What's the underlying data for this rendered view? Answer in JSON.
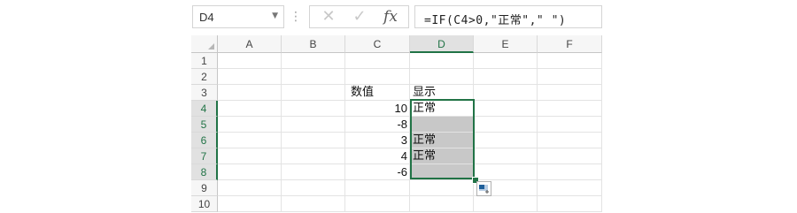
{
  "formula_bar": {
    "name_box": "D4",
    "dots": "⋮",
    "cancel_glyph": "✕",
    "enter_glyph": "✓",
    "fx_glyph": "fx",
    "formula": "=IF(C4>0,\"正常\",\" \")"
  },
  "grid": {
    "columns": [
      "A",
      "B",
      "C",
      "D",
      "E",
      "F"
    ],
    "selected_column": "D",
    "rows": [
      "1",
      "2",
      "3",
      "4",
      "5",
      "6",
      "7",
      "8",
      "9",
      "10"
    ],
    "selected_rows": [
      "4",
      "5",
      "6",
      "7",
      "8"
    ],
    "cells": {
      "C3": "数值",
      "D3": "显示",
      "C4": "10",
      "D4": "正常",
      "C5": "-8",
      "D5": "",
      "C6": "3",
      "D6": "正常",
      "C7": "4",
      "D7": "正常",
      "C8": "-6",
      "D8": ""
    }
  },
  "colors": {
    "accent": "#217346",
    "shade": "#c8c8c8"
  }
}
